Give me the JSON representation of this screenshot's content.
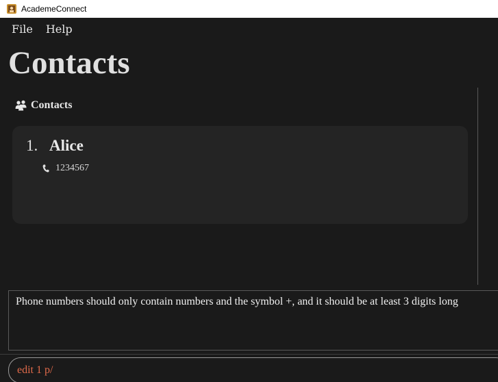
{
  "window": {
    "title": "AcademeConnect"
  },
  "menu": {
    "items": [
      "File",
      "Help"
    ]
  },
  "page": {
    "title": "Contacts"
  },
  "contacts_panel": {
    "header": "Contacts"
  },
  "contacts": [
    {
      "index": "1.",
      "name": "Alice",
      "phone": "1234567"
    }
  ],
  "result": {
    "message": "Phone numbers should only contain numbers and the symbol +, and it should be at least 3 digits long"
  },
  "command": {
    "value": "edit 1 p/",
    "error_color": "#e06a4a"
  }
}
